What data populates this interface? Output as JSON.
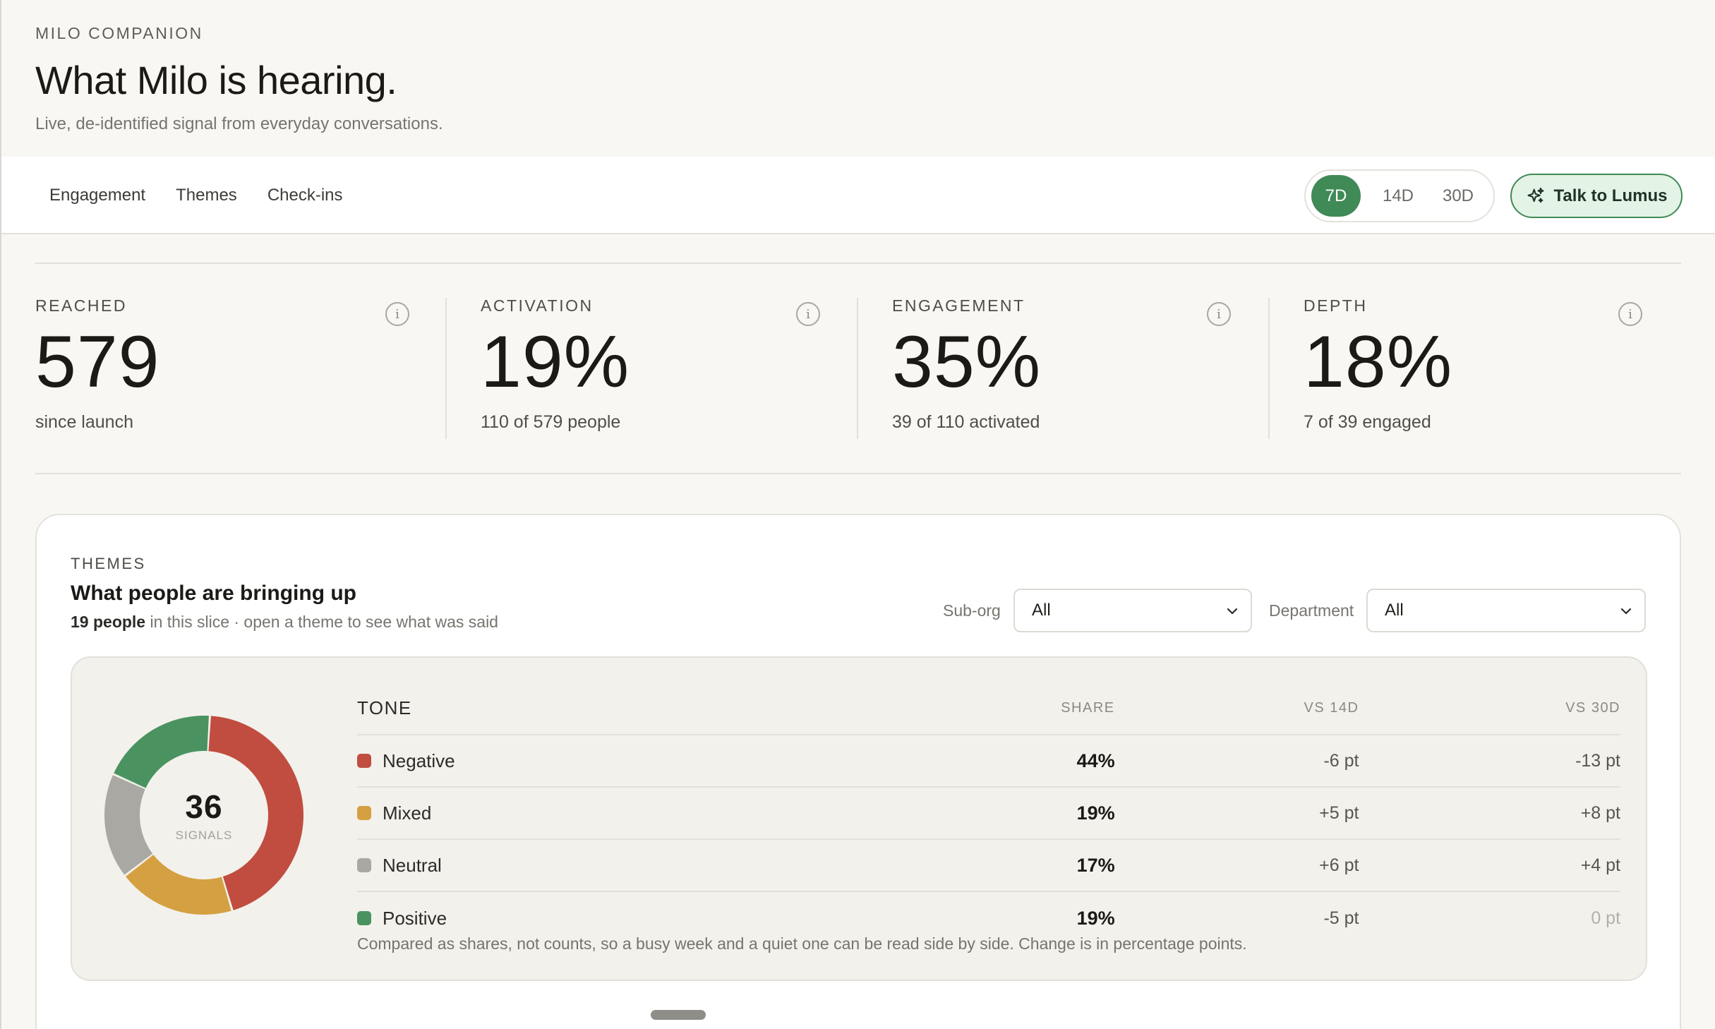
{
  "header": {
    "eyebrow": "MILO COMPANION",
    "title": "What Milo is hearing.",
    "subtitle": "Live, de-identified signal from everyday conversations."
  },
  "nav": {
    "links": [
      "Engagement",
      "Themes",
      "Check-ins"
    ],
    "ranges": [
      "7D",
      "14D",
      "30D"
    ],
    "active_range": "7D",
    "cta_label": "Talk to Lumus",
    "cta_icon": "sparkle-icon"
  },
  "kpis": [
    {
      "label": "REACHED",
      "value": "579",
      "sub": "since launch"
    },
    {
      "label": "ACTIVATION",
      "value": "19%",
      "sub": "110 of 579 people"
    },
    {
      "label": "ENGAGEMENT",
      "value": "35%",
      "sub": "39 of 110 activated"
    },
    {
      "label": "DEPTH",
      "value": "18%",
      "sub": "7 of 39 engaged"
    }
  ],
  "themes": {
    "eyebrow": "THEMES",
    "title": "What people are bringing up",
    "people_count": "19 people",
    "sub_rest": " in this slice · open a theme to see what was said",
    "filters": {
      "suborg_label": "Sub-org",
      "suborg_value": "All",
      "department_label": "Department",
      "department_value": "All"
    },
    "donut": {
      "total": "36",
      "caption": "SIGNALS"
    },
    "table": {
      "headers": {
        "tone": "TONE",
        "share": "SHARE",
        "vs14": "VS 14D",
        "vs30": "VS 30D"
      },
      "rows": [
        {
          "tone": "Negative",
          "share": "44%",
          "vs14": "-6 pt",
          "vs30": "-13 pt",
          "color": "#c04d3f"
        },
        {
          "tone": "Mixed",
          "share": "19%",
          "vs14": "+5 pt",
          "vs30": "+8 pt",
          "color": "#d4a041"
        },
        {
          "tone": "Neutral",
          "share": "17%",
          "vs14": "+6 pt",
          "vs30": "+4 pt",
          "color": "#a9a8a3"
        },
        {
          "tone": "Positive",
          "share": "19%",
          "vs14": "-5 pt",
          "vs30": "0 pt",
          "color": "#4a9360"
        }
      ]
    },
    "note": "Compared as shares, not counts, so a busy week and a quiet one can be read side by side. Change is in percentage points."
  },
  "chart_data": {
    "type": "pie",
    "categories": [
      "Negative",
      "Mixed",
      "Neutral",
      "Positive"
    ],
    "values": [
      44,
      19,
      17,
      19
    ],
    "colors": [
      "#c04d3f",
      "#d4a041",
      "#a9a8a3",
      "#4a9360"
    ]
  }
}
